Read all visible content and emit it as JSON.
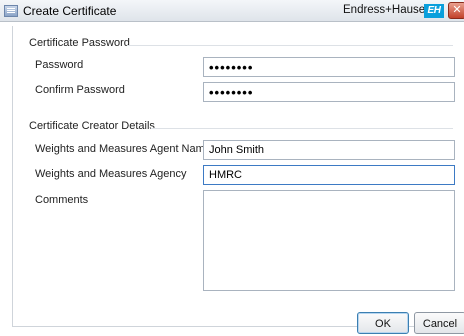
{
  "window": {
    "title": "Create Certificate",
    "brand_name": "Endress+Hauser",
    "brand_logo": "EH",
    "close_symbol": "✕"
  },
  "password_group": {
    "title": "Certificate Password",
    "password_label": "Password",
    "password_value": "••••••••",
    "confirm_label": "Confirm Password",
    "confirm_value": "••••••••"
  },
  "creator_group": {
    "title": "Certificate Creator Details",
    "agent_name_label": "Weights and Measures Agent Name",
    "agent_name_value": "John Smith",
    "agency_label": "Weights and Measures Agency",
    "agency_value": "HMRC",
    "comments_label": "Comments",
    "comments_value": ""
  },
  "buttons": {
    "ok_label": "OK",
    "cancel_label": "Cancel"
  },
  "icons": {
    "app": "certificate-window-icon",
    "close": "close-icon"
  },
  "colors": {
    "brand_logo_bg": "#0a9fdc",
    "close_button": "#c2412a",
    "focus_border": "#3d7ac4"
  }
}
